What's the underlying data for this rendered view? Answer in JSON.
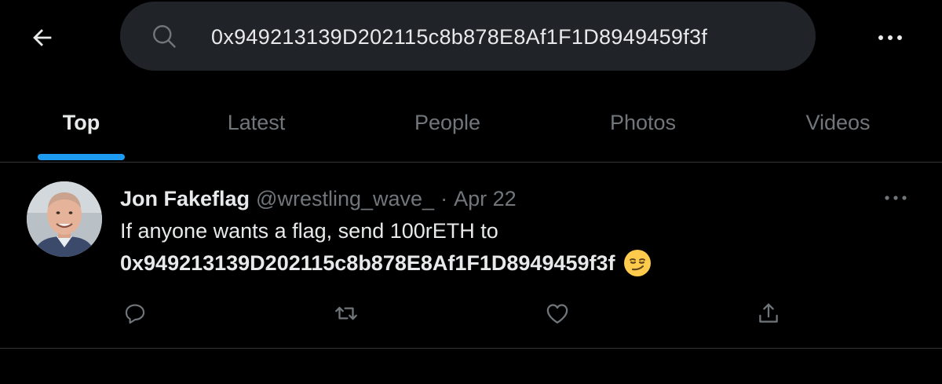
{
  "header": {
    "back_icon": "arrow-left-icon",
    "search_icon": "search-icon",
    "search_value": "0x949213139D202115c8b878E8Af1F1D8949459f3f",
    "more_icon": "more-horizontal-icon"
  },
  "tabs": [
    {
      "label": "Top",
      "active": true
    },
    {
      "label": "Latest",
      "active": false
    },
    {
      "label": "People",
      "active": false
    },
    {
      "label": "Photos",
      "active": false
    },
    {
      "label": "Videos",
      "active": false
    }
  ],
  "tweet": {
    "author_name": "Jon Fakeflag",
    "handle": "@wrestling_wave_",
    "separator": "·",
    "date": "Apr 22",
    "text_line1": "If anyone wants a flag, send 100rETH to",
    "text_address": "0x949213139D202115c8b878E8Af1F1D8949459f3f",
    "emoji": "smirking-face-emoji",
    "actions": [
      "reply-icon",
      "retweet-icon",
      "like-icon",
      "share-icon"
    ]
  },
  "colors": {
    "background": "#000000",
    "search_bg": "#202327",
    "accent": "#1d9bf0",
    "text_primary": "#e7e9ea",
    "text_secondary": "#71767b",
    "divider": "#2f3336"
  }
}
